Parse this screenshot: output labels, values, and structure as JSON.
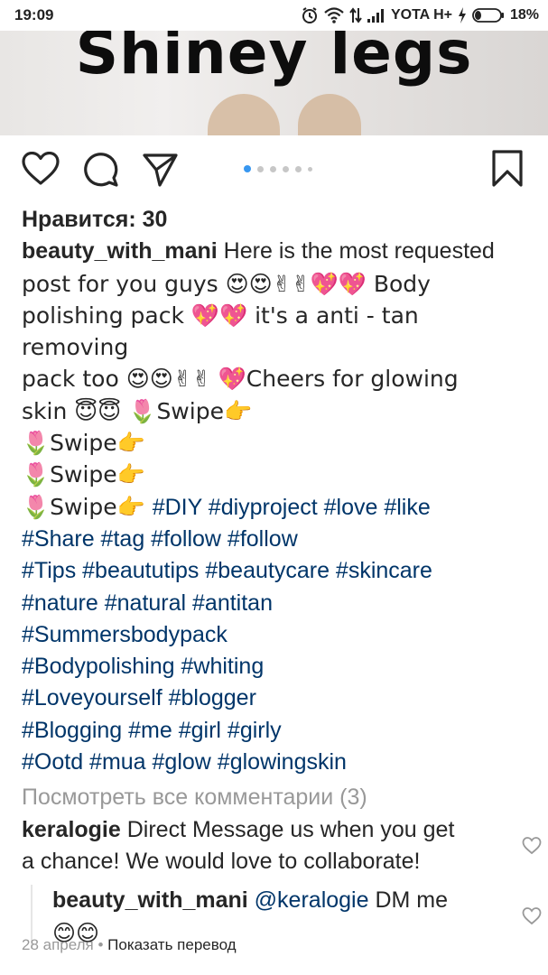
{
  "status_bar": {
    "time": "19:09",
    "carrier": "YOTA H+",
    "battery": "18%",
    "icons": [
      "alarm-icon",
      "wifi-icon",
      "data-arrows-icon",
      "signal-icon",
      "charging-icon",
      "battery-icon"
    ]
  },
  "post_image": {
    "overlay_text": "Shiney legs"
  },
  "actions": {
    "icons": [
      "heart-icon",
      "comment-icon",
      "share-icon",
      "bookmark-icon"
    ],
    "carousel_dots": 6,
    "carousel_active": 0
  },
  "likes": "Нравится: 30",
  "caption": {
    "user": "beauty_with_mani",
    "line1": " Here is the most requested",
    "line2": "post for you guys 😍😍✌✌💖💖 Body",
    "line3": "polishing pack 💖💖 it's a anti - tan removing",
    "line4": "pack too 😍😍✌✌ 💖Cheers for glowing",
    "line5": "skin 😇😇 🌷Swipe👉",
    "line6": "🌷Swipe👉",
    "line7": "🌷Swipe👉",
    "line8_text": "🌷Swipe👉  ",
    "line8_tags": "#DIY #diyproject #love #like",
    "tags": [
      "#Share #tag #follow #follow",
      "#Tips #beaututips #beautycare #skincare",
      "#nature #natural #antitan",
      "#Summersbodypack",
      "#Bodypolishing #whiting",
      "#Loveyourself #blogger",
      "#Blogging #me #girl #girly",
      "#Ootd #mua #glow #glowingskin"
    ]
  },
  "view_all_comments": "Посмотреть все комментарии (3)",
  "comment": {
    "user": "keralogie",
    "text": " Direct Message us when you get",
    "text2": "a chance! We would love to collaborate!"
  },
  "reply": {
    "user": "beauty_with_mani",
    "mention": " @keralogie",
    "text": " DM me",
    "text2": "😊😊"
  },
  "meta": {
    "date": "28 апреля",
    "separator": " • ",
    "translate": "Показать перевод"
  }
}
